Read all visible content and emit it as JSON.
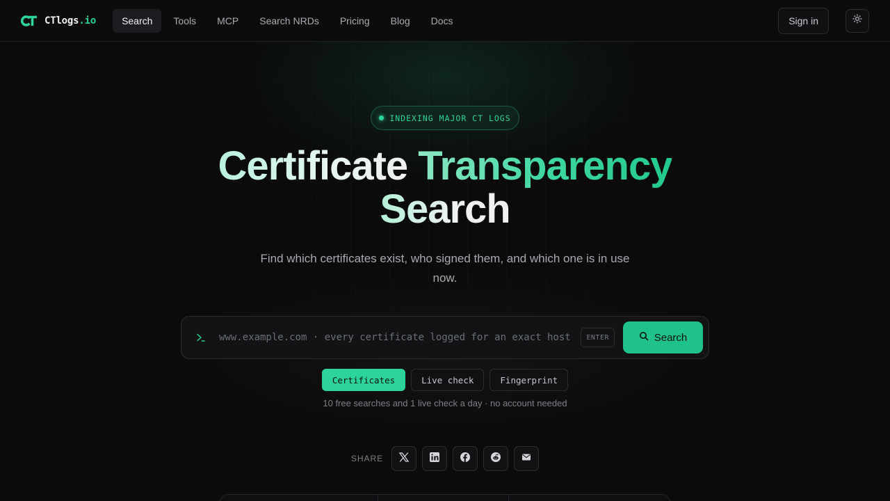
{
  "brand": {
    "name": "CTlogs",
    "tld": ".io",
    "accent": "#2dd49a"
  },
  "nav": {
    "items": [
      {
        "label": "Search",
        "active": true
      },
      {
        "label": "Tools"
      },
      {
        "label": "MCP"
      },
      {
        "label": "Search NRDs"
      },
      {
        "label": "Pricing"
      },
      {
        "label": "Blog"
      },
      {
        "label": "Docs"
      }
    ],
    "signin_label": "Sign in",
    "theme_icon": "sun-icon"
  },
  "hero": {
    "badge": "INDEXING MAJOR CT LOGS",
    "title_part1": "Certificate",
    "title_part2": "Transparency",
    "title_part3": "Search",
    "subtitle": "Find which certificates exist, who signed them, and which one is in use now."
  },
  "search": {
    "placeholder": "www.example.com · every certificate logged for an exact host",
    "enter_hint": "ENTER",
    "button_label": "Search"
  },
  "modes": [
    {
      "label": "Certificates",
      "active": true
    },
    {
      "label": "Live check"
    },
    {
      "label": "Fingerprint"
    }
  ],
  "note": "10 free searches and 1 live check a day · no account needed",
  "share": {
    "label": "SHARE",
    "targets": [
      "x-icon",
      "linkedin-icon",
      "facebook-icon",
      "reddit-icon",
      "mail-icon"
    ]
  }
}
